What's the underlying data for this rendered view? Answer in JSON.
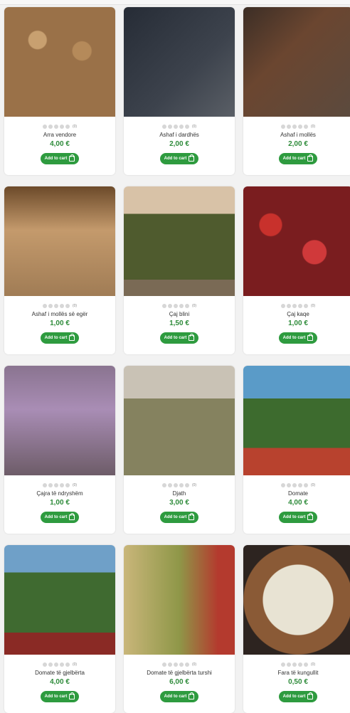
{
  "cart_label": "Add to cart",
  "products": [
    {
      "name": "Arra vendore",
      "price": "4,00 €",
      "reviews": "(0)",
      "image": "walnuts"
    },
    {
      "name": "Ashaf i dardhës",
      "price": "2,00 €",
      "reviews": "(0)",
      "image": "dried-pears"
    },
    {
      "name": "Ashaf i mollës",
      "price": "2,00 €",
      "reviews": "(0)",
      "image": "dried-apples"
    },
    {
      "name": "Ashaf i mollës së egër",
      "price": "1,00 €",
      "reviews": "(0)",
      "image": "dried-wild-apples"
    },
    {
      "name": "Çaj blini",
      "price": "1,50 €",
      "reviews": "(0)",
      "image": "linden-tea"
    },
    {
      "name": "Çaj kaqe",
      "price": "1,00 €",
      "reviews": "(0)",
      "image": "rosehip-tea"
    },
    {
      "name": "Çajra të ndryshëm",
      "price": "1,00 €",
      "reviews": "(0)",
      "image": "various-teas"
    },
    {
      "name": "Djath",
      "price": "3,00 €",
      "reviews": "(0)",
      "image": "cheese"
    },
    {
      "name": "Domate",
      "price": "4,00 €",
      "reviews": "(0)",
      "image": "tomato-jar"
    },
    {
      "name": "Domate të gjelbërta",
      "price": "4,00 €",
      "reviews": "(0)",
      "image": "green-tomato-jar"
    },
    {
      "name": "Domate të gjelbërta turshi",
      "price": "6,00 €",
      "reviews": "(0)",
      "image": "pickled-green-tomatoes"
    },
    {
      "name": "Fara të kungullit",
      "price": "0,50 €",
      "reviews": "(0)",
      "image": "pumpkin-seeds"
    }
  ],
  "colors": {
    "accent": "#2e9b3f",
    "price": "#2e8b3a"
  }
}
